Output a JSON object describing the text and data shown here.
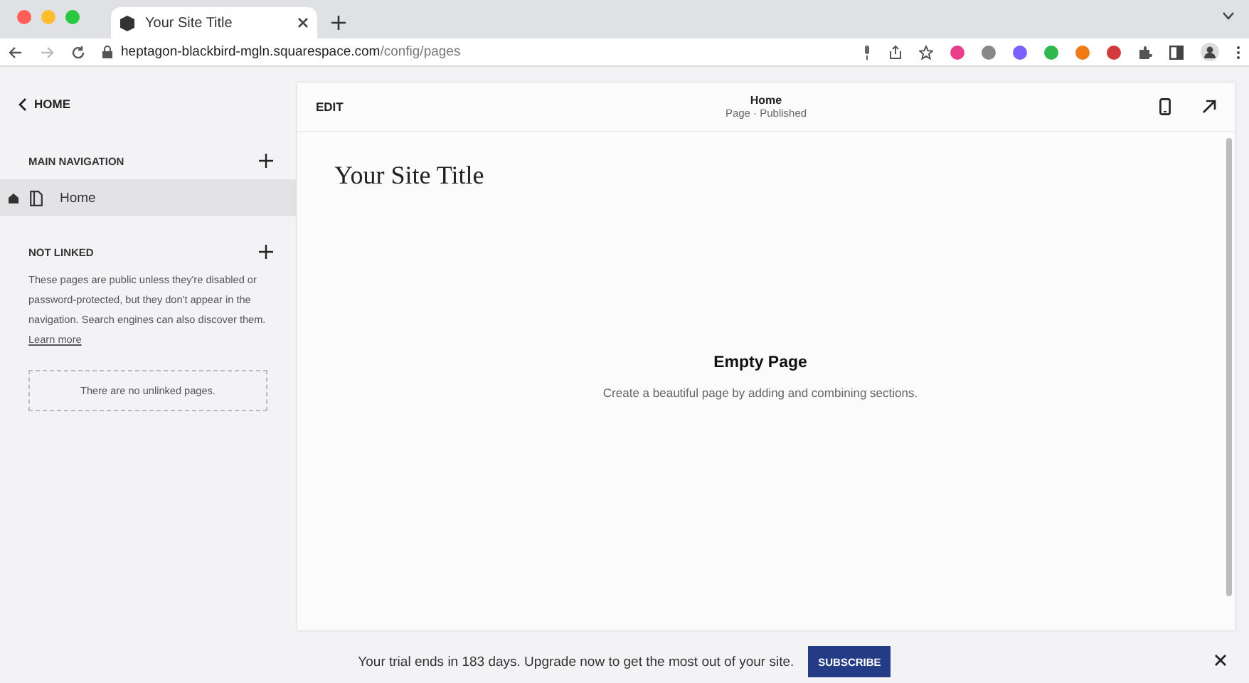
{
  "browser": {
    "tab_title": "Your Site Title",
    "url_host": "heptagon-blackbird-mgln.squarespace.com",
    "url_path": "/config/pages"
  },
  "sidebar": {
    "back_label": "HOME",
    "sections": [
      {
        "kind": "nav",
        "title": "MAIN NAVIGATION",
        "pages": [
          {
            "label": "Home",
            "selected": true
          }
        ]
      },
      {
        "kind": "unlinked",
        "title": "NOT LINKED",
        "description": "These pages are public unless they're disabled or password-protected, but they don't appear in the navigation. Search engines can also discover them.",
        "link": "Learn more",
        "empty_text": "There are no unlinked pages."
      }
    ]
  },
  "editor": {
    "edit_label": "EDIT",
    "page_title": "Home",
    "page_status": "Page · Published",
    "site_title": "Your Site Title",
    "empty_title": "Empty Page",
    "empty_text": "Create a beautiful page by adding and combining sections."
  },
  "trial_bar": {
    "message": "Your trial ends in 183 days. Upgrade now to get the most out of your site.",
    "button": "SUBSCRIBE"
  }
}
